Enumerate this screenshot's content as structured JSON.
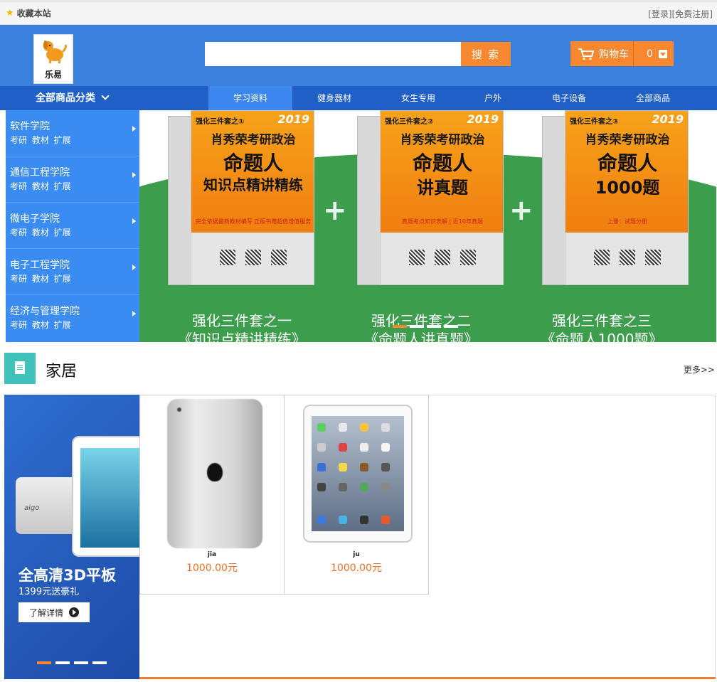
{
  "topbar": {
    "favorite": "收藏本站",
    "login": "登录",
    "register": "免费注册"
  },
  "header": {
    "logo_text": "乐易",
    "search_placeholder": "",
    "search_button": "搜 索",
    "cart_label": "购物车",
    "cart_count": "0"
  },
  "nav": {
    "all_categories": "全部商品分类",
    "tabs": [
      {
        "label": "学习资料",
        "active": true
      },
      {
        "label": "健身器材",
        "active": false
      },
      {
        "label": "女生专用",
        "active": false
      },
      {
        "label": "户外",
        "active": false
      },
      {
        "label": "电子设备",
        "active": false
      },
      {
        "label": "全部商品",
        "active": false
      }
    ]
  },
  "sidebar": {
    "items": [
      {
        "title": "软件学院",
        "sub": "考研 教材 扩展"
      },
      {
        "title": "通信工程学院",
        "sub": "考研 教材 扩展"
      },
      {
        "title": "微电子学院",
        "sub": "考研 教材 扩展"
      },
      {
        "title": "电子工程学院",
        "sub": "考研 教材 扩展"
      },
      {
        "title": "经济与管理学院",
        "sub": "考研 教材 扩展"
      }
    ]
  },
  "banner": {
    "books": [
      {
        "series": "强化三件套之①",
        "year": "2019",
        "line1": "肖秀荣考研政治",
        "line2": "命题人",
        "line3": "知识点精讲精练",
        "foot": "完全依据最新教材编写 正版书赠超值增值服务",
        "cap1": "强化三件套之一",
        "cap2": "《知识点精讲精练》"
      },
      {
        "series": "强化三件套之②",
        "year": "2019",
        "line1": "肖秀荣考研政治",
        "line2": "命题人",
        "line3": "讲真题",
        "foot": "真题考点知识表解 | 近10年真题",
        "cap1": "强化三件套之二",
        "cap2": "《命题人讲真题》"
      },
      {
        "series": "强化三件套之③",
        "year": "2019",
        "line1": "肖秀荣考研政治",
        "line2": "命题人",
        "line3": "1000题",
        "foot": "上册：试题分册",
        "cap1": "强化三件套之三",
        "cap2": "《命题人1000题》"
      }
    ],
    "active_slide": 1,
    "slide_count": 4
  },
  "section": {
    "title": "家居",
    "more": "更多>>",
    "promo": {
      "brand": "aigo",
      "title": "全高清3D平板",
      "subtitle": "1399元送豪礼",
      "button": "了解详情",
      "active_slide": 1,
      "slide_count": 4
    },
    "products": [
      {
        "name": "jia",
        "price": "1000.00元"
      },
      {
        "name": "ju",
        "price": "1000.00元"
      }
    ]
  },
  "colors": {
    "header_blue": "#3b80dc",
    "nav_blue": "#1f5fc6",
    "accent_orange": "#f7882f",
    "section_teal": "#40c1b9",
    "banner_green": "#3c9e4c"
  }
}
